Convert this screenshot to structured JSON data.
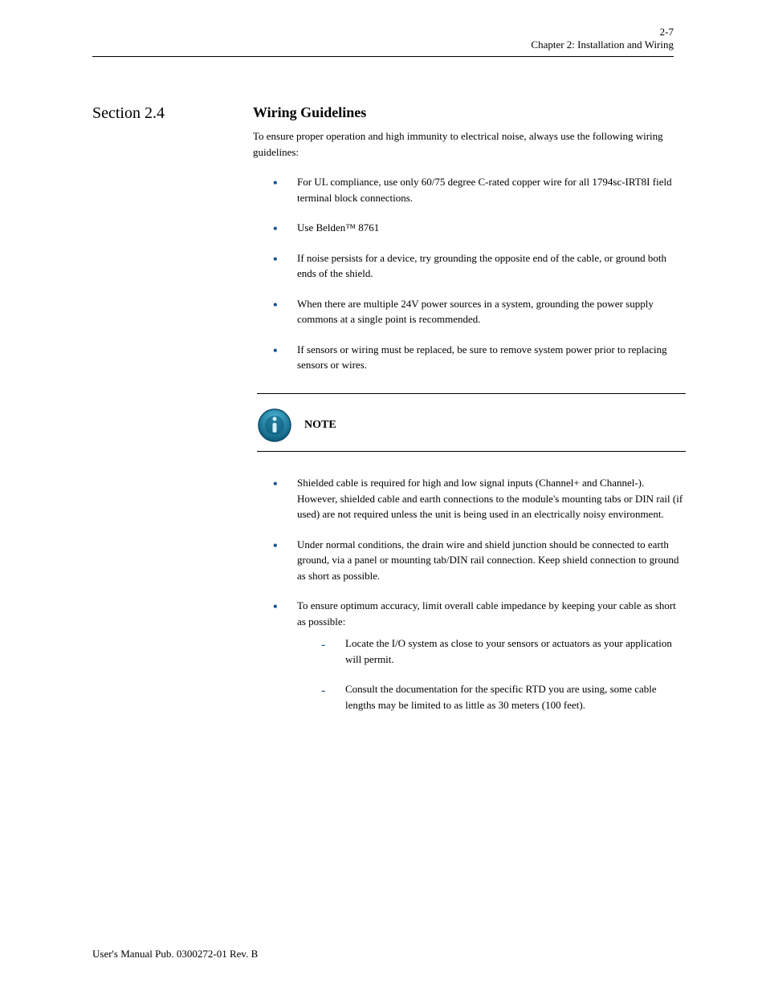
{
  "header": {
    "page_num": "2-7",
    "chapter": "Chapter 2: Installation and Wiring"
  },
  "section1": {
    "title": "Section 2.4",
    "heading": "Wiring Guidelines",
    "intro": "To ensure proper operation and high immunity to electrical noise, always use the following wiring guidelines:",
    "bullets": [
      "For UL compliance, use only 60/75 degree C-rated copper wire for all 1794sc-IRT8I field terminal block connections.",
      "Use Belden™ 8761",
      "If noise persists for a device, try grounding the opposite end of the cable, or ground both ends of the shield.",
      "When there are multiple 24V power sources in a system, grounding the power supply commons at a single point is recommended.",
      "If sensors or wiring must be replaced, be sure to remove system power prior to replacing sensors or wires."
    ]
  },
  "note": {
    "label": "NOTE",
    "bullets": [
      "Shielded cable is required for high and low signal inputs (Channel+ and Channel-). However, shielded cable and earth connections to the module's mounting tabs or DIN rail (if used) are not required unless the unit is being used in an electrically noisy environment.",
      "Under normal conditions, the drain wire and shield junction should be connected to earth ground, via a panel or mounting tab/DIN rail connection. Keep shield connection to ground as short as possible.",
      "To ensure optimum accuracy, limit overall cable impedance by keeping your cable as short as possible:"
    ],
    "sub_bullets": [
      "Locate the I/O system as close to your sensors or actuators as your application will permit.",
      "Consult the documentation for the specific RTD you are using, some cable lengths may be limited to as little as 30 meters (100 feet)."
    ]
  },
  "footer": {
    "text": "User's Manual Pub. 0300272-01 Rev. B"
  }
}
